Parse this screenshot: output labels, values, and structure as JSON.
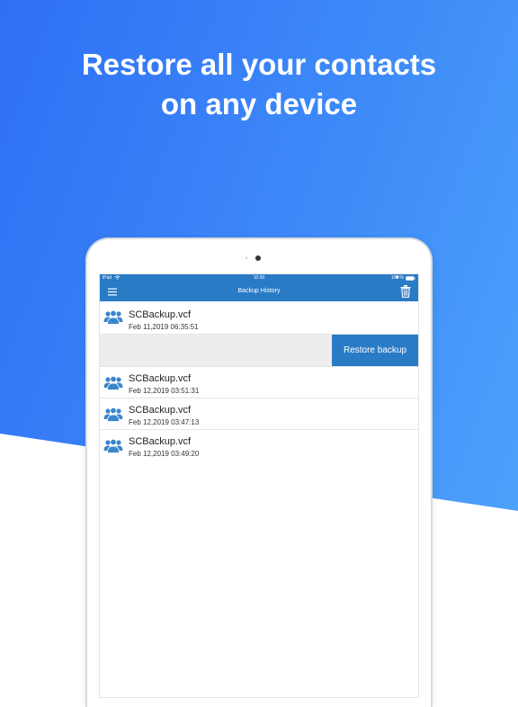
{
  "headline": {
    "line1": "Restore all your contacts",
    "line2": "on any device"
  },
  "statusbar": {
    "carrier": "iPad",
    "time": "10:30",
    "battery": "100 %"
  },
  "navbar": {
    "title": "Backup History",
    "menu_icon": "hamburger-menu-icon",
    "trash_icon": "trash-icon"
  },
  "backups": [
    {
      "name": "SCBackup.vcf",
      "date": "Feb 11,2019 06:35:51"
    },
    {
      "name": "SCBackup.vcf",
      "date": "Feb 12,2019 03:51:31"
    },
    {
      "name": "SCBackup.vcf",
      "date": "Feb 12,2019 03:47:13"
    },
    {
      "name": "SCBackup.vcf",
      "date": "Feb 12,2019 03:49:20"
    }
  ],
  "action": {
    "restore_label": "Restore backup"
  },
  "colors": {
    "accent": "#2a7bc6",
    "gradient_start": "#2f6ff5",
    "gradient_end": "#4fa6fb"
  }
}
